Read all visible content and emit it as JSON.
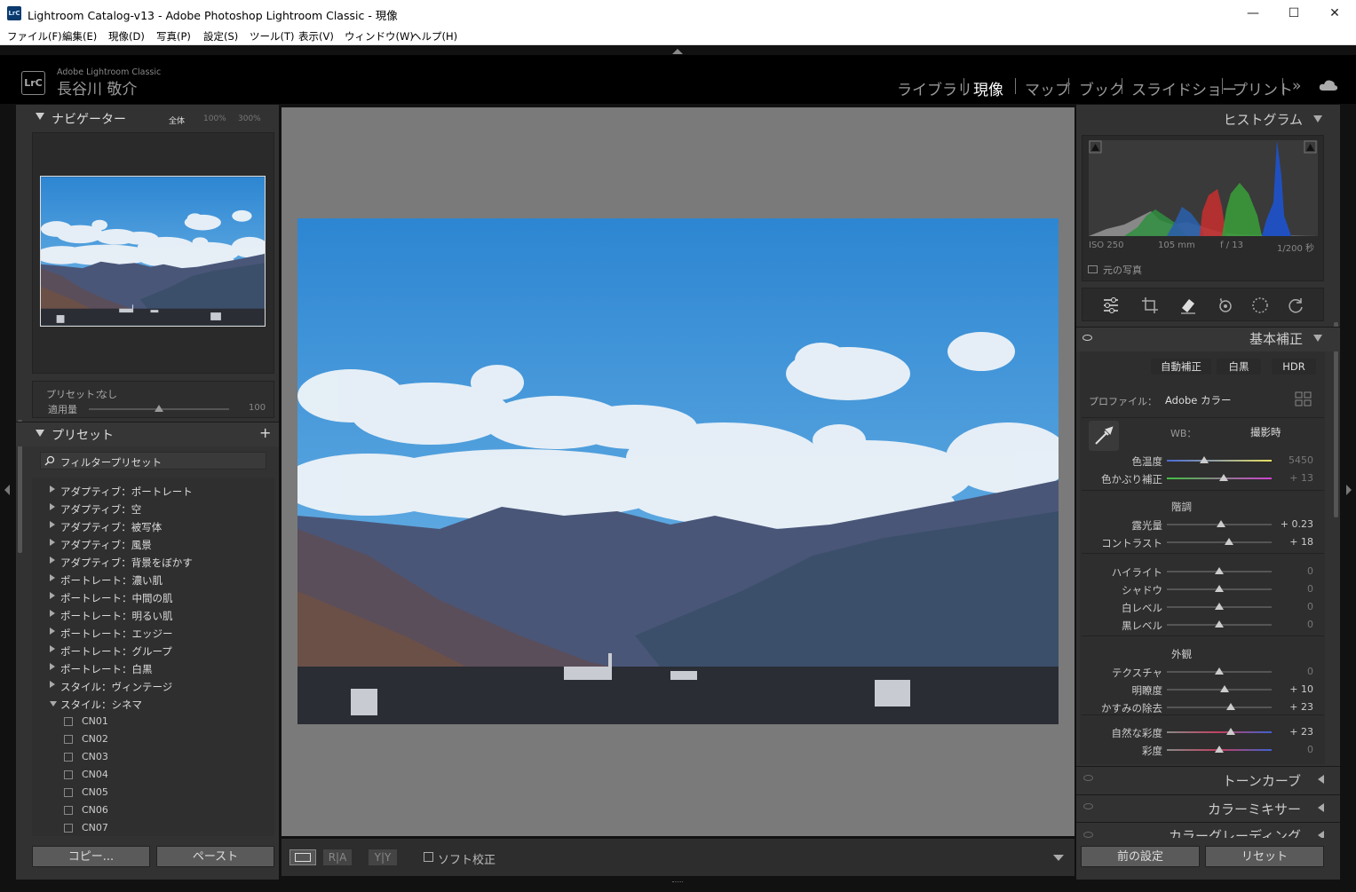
{
  "titlebar": {
    "title": "Lightroom Catalog-v13 - Adobe Photoshop Lightroom Classic - 現像",
    "app_icon": "LrC",
    "minimize": "—",
    "maximize": "☐",
    "close": "✕"
  },
  "menu": [
    "ファイル(F)",
    "編集(E)",
    "現像(D)",
    "写真(P)",
    "設定(S)",
    "ツール(T)",
    "表示(V)",
    "ウィンドウ(W)",
    "ヘルプ(H)"
  ],
  "identity": {
    "logo": "LrC",
    "brand": "Adobe Lightroom Classic",
    "user": "長谷川 敬介"
  },
  "modules": [
    {
      "label": "ライブラリ",
      "active": false
    },
    {
      "label": "現像",
      "active": true
    },
    {
      "label": "マップ",
      "active": false
    },
    {
      "label": "ブック",
      "active": false
    },
    {
      "label": "スライドショー",
      "active": false
    },
    {
      "label": "プリント",
      "active": false
    }
  ],
  "module_more": "»",
  "navigator": {
    "title": "ナビゲーター",
    "zoom_fit": "全体",
    "zoom_100": "100%",
    "zoom_300": "300%"
  },
  "preset_amount": {
    "preset_label": "プリセット：",
    "preset_value": "なし",
    "amount_label": "適用量",
    "amount_value": "100",
    "amount_level": 0.5
  },
  "presets": {
    "title": "プリセット",
    "add": "+",
    "filter_placeholder": "フィルタープリセット",
    "groups": [
      "アダプティブ：ポートレート",
      "アダプティブ：空",
      "アダプティブ：被写体",
      "アダプティブ：風景",
      "アダプティブ：背景をぼかす",
      "ポートレート：濃い肌",
      "ポートレート：中間の肌",
      "ポートレート：明るい肌",
      "ポートレート：エッジー",
      "ポートレート：グループ",
      "ポートレート：白黒",
      "スタイル：ヴィンテージ",
      "スタイル：シネマ"
    ],
    "expanded_items": [
      "CN01",
      "CN02",
      "CN03",
      "CN04",
      "CN05",
      "CN06",
      "CN07"
    ]
  },
  "left_buttons": {
    "copy": "コピー...",
    "paste": "ペースト"
  },
  "toolbar": {
    "soft_proof": "ソフト校正",
    "view_ra": "R|A",
    "view_yy": "Y|Y"
  },
  "histogram": {
    "title": "ヒストグラム",
    "iso": "ISO 250",
    "focal": "105 mm",
    "aperture": "f / 13",
    "shutter": "1/200 秒",
    "original": "元の写真"
  },
  "basic": {
    "title": "基本補正",
    "auto": "自動補正",
    "bw": "白黒",
    "hdr": "HDR",
    "profile_label": "プロファイル：",
    "profile_value": "Adobe カラー",
    "wb_label": "WB：",
    "wb_value": "撮影時",
    "tone_head": "階調",
    "presence_head": "外観",
    "sliders": [
      {
        "name": "色温度",
        "value": "5450",
        "level": 0.36,
        "dim": true
      },
      {
        "name": "色かぶり補正",
        "value": "+ 13",
        "level": 0.54,
        "dim": true
      },
      {
        "name": "露光量",
        "value": "+ 0.23",
        "level": 0.52,
        "dim": false
      },
      {
        "name": "コントラスト",
        "value": "+ 18",
        "level": 0.59,
        "dim": false
      },
      {
        "name": "ハイライト",
        "value": "0",
        "level": 0.5,
        "dim": true
      },
      {
        "name": "シャドウ",
        "value": "0",
        "level": 0.5,
        "dim": true
      },
      {
        "name": "白レベル",
        "value": "0",
        "level": 0.5,
        "dim": true
      },
      {
        "name": "黒レベル",
        "value": "0",
        "level": 0.5,
        "dim": true
      },
      {
        "name": "テクスチャ",
        "value": "0",
        "level": 0.5,
        "dim": true
      },
      {
        "name": "明瞭度",
        "value": "+ 10",
        "level": 0.55,
        "dim": false
      },
      {
        "name": "かすみの除去",
        "value": "+ 23",
        "level": 0.61,
        "dim": false
      },
      {
        "name": "自然な彩度",
        "value": "+ 23",
        "level": 0.61,
        "dim": false
      },
      {
        "name": "彩度",
        "value": "0",
        "level": 0.5,
        "dim": true
      }
    ]
  },
  "collapsed_panels": [
    "トーンカーブ",
    "カラーミキサー",
    "カラーグレーディング"
  ],
  "right_buttons": {
    "previous": "前の設定",
    "reset": "リセット"
  },
  "colors": {
    "panel": "#323232",
    "center": "#7a7a7a",
    "sky": "#3a8fd6",
    "accent": "#ffffff"
  }
}
